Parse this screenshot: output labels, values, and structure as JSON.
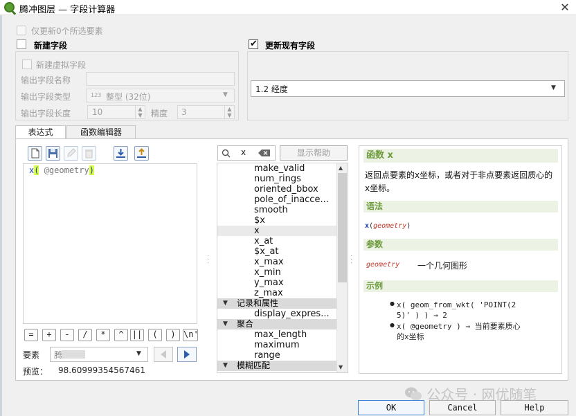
{
  "window": {
    "title": "腾冲图层 — 字段计算器",
    "close_glyph": "✕"
  },
  "only_selected": {
    "label": "仅更新0个所选要素"
  },
  "new_field": {
    "label": "新建字段",
    "checked": false
  },
  "update_field": {
    "label": "更新现有字段",
    "checked": true,
    "selected": "1.2 经度"
  },
  "virtual_field": {
    "label": "新建虚拟字段"
  },
  "output": {
    "name_label": "输出字段名称",
    "type_label": "输出字段类型",
    "type_value": "整型 (32位)",
    "type_icon_text": "123",
    "length_label": "输出字段长度",
    "length_value": "10",
    "precision_label": "精度",
    "precision_value": "3"
  },
  "tabs": [
    "表达式",
    "函数编辑器"
  ],
  "editor": {
    "code_fn": "x",
    "code_open": "(",
    "code_arg": " @geometry",
    "code_close": ")",
    "toolbar_icons": [
      "new-file-icon",
      "save-icon",
      "edit-icon",
      "delete-icon",
      "download-icon",
      "upload-icon"
    ]
  },
  "operators": [
    "=",
    "+",
    "-",
    "/",
    "*",
    "^",
    "||",
    "(",
    ")",
    "\\n'"
  ],
  "feature": {
    "label": "要素",
    "value": "腾"
  },
  "preview": {
    "label": "预览：",
    "value": "98.60999354567461"
  },
  "search": {
    "value": "x",
    "show_help_label": "显示帮助"
  },
  "function_list": [
    {
      "kind": "item",
      "text": "make_valid"
    },
    {
      "kind": "item",
      "text": "num_rings"
    },
    {
      "kind": "item",
      "text": "oriented_bbox"
    },
    {
      "kind": "item",
      "text": "pole_of_inacce..."
    },
    {
      "kind": "item",
      "text": "smooth"
    },
    {
      "kind": "item",
      "text": "$x"
    },
    {
      "kind": "item",
      "text": "x",
      "selected": true
    },
    {
      "kind": "item",
      "text": "x_at"
    },
    {
      "kind": "item",
      "text": "$x_at"
    },
    {
      "kind": "item",
      "text": "x_max"
    },
    {
      "kind": "item",
      "text": "x_min"
    },
    {
      "kind": "item",
      "text": "y_max"
    },
    {
      "kind": "item",
      "text": "z_max"
    },
    {
      "kind": "group",
      "text": "记录和属性"
    },
    {
      "kind": "item",
      "text": "display_expres..."
    },
    {
      "kind": "group",
      "text": "聚合"
    },
    {
      "kind": "item",
      "text": "max_length"
    },
    {
      "kind": "item",
      "text": "maximum"
    },
    {
      "kind": "item",
      "text": "range"
    },
    {
      "kind": "group",
      "text": "模糊匹配"
    }
  ],
  "help": {
    "title": "函数 x",
    "description": "返回点要素的x坐标，或者对于非点要素返回质心的x坐标。",
    "syntax_header": "语法",
    "syntax_fn": "x",
    "syntax_arg": "geometry",
    "params_header": "参数",
    "param_name": "geometry",
    "param_desc": "一个几何图形",
    "examples_header": "示例",
    "example1_a": "x( geom_from_wkt( 'POINT(2",
    "example1_b": "5)' ) ) → 2",
    "example2_a": "x( @geometry ) → 当前要素质心",
    "example2_b": "的x坐标"
  },
  "buttons": {
    "ok": "OK",
    "cancel": "Cancel",
    "help": "Help"
  },
  "watermark": "公众号 · 网优随笔",
  "colors": {
    "accent_green": "#6d9b3c",
    "fn_blue": "#1a3fb8",
    "param_red": "#c0392b",
    "highlight": "#d7ff3c"
  }
}
